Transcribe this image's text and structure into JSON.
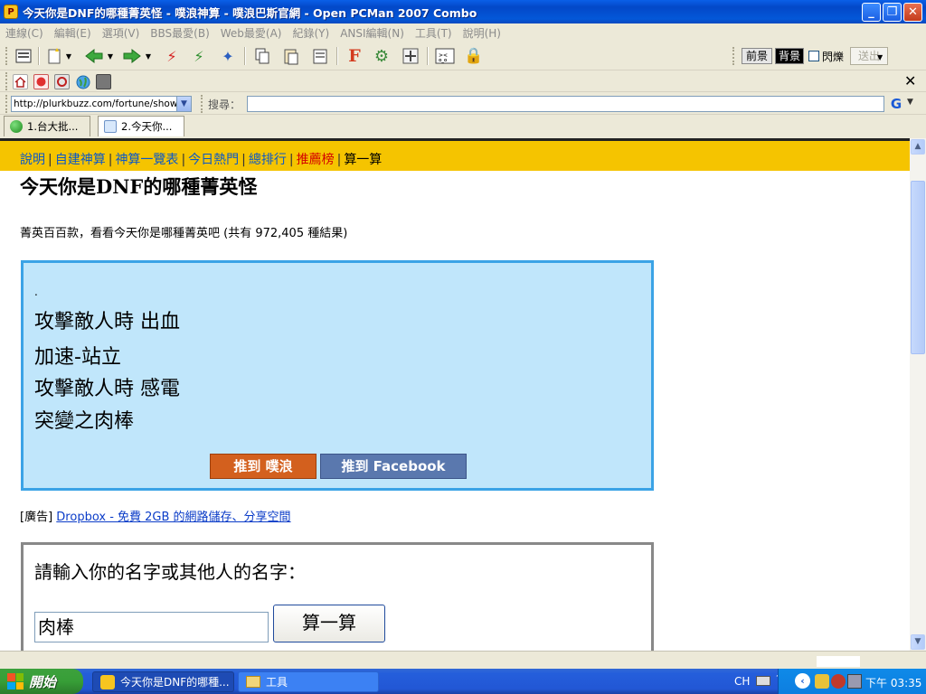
{
  "window": {
    "title": "今天你是DNF的哪種菁英怪 - 噗浪神算 - 噗浪巴斯官網 - Open PCMan 2007 Combo",
    "minimize": "_",
    "restore": "❐",
    "close": "✕"
  },
  "menu": [
    "連線(C)",
    "編輯(E)",
    "選項(V)",
    "BBS最愛(B)",
    "Web最愛(A)",
    "紀錄(Y)",
    "ANSI編輯(N)",
    "工具(T)",
    "說明(H)"
  ],
  "toolbar": {
    "fg_label": "前景",
    "bg_label": "背景",
    "blink_label": "閃爍",
    "send_label": "送出"
  },
  "address": {
    "url": "http://plurkbuzz.com/fortune/show/Dg",
    "search_label": "搜尋：",
    "search_value": ""
  },
  "tabs": [
    {
      "label": "1.台大批..."
    },
    {
      "label": "2.今天你..."
    }
  ],
  "page": {
    "nav": [
      {
        "label": "說明"
      },
      {
        "label": "自建神算"
      },
      {
        "label": "神算一覽表"
      },
      {
        "label": "今日熱門"
      },
      {
        "label": "總排行"
      },
      {
        "label": "推薦榜"
      },
      {
        "label": "算一算"
      }
    ],
    "nav_sep": "|",
    "title": "今天你是DNF的哪種菁英怪",
    "subtitle": "菁英百百款，看看今天你是哪種菁英吧 (共有 972,405 種結果)",
    "result_dot": ".",
    "result_lines": [
      "攻擊敵人時 出血",
      "加速-站立",
      "攻擊敵人時 感電",
      "突變之肉棒"
    ],
    "share_plurk": "推到 噗浪",
    "share_facebook": "推到 Facebook",
    "ad_prefix": "[廣告]",
    "ad_link": "Dropbox - 免費 2GB 的網路儲存、分享空間",
    "form_label": "請輸入你的名字或其他人的名字：",
    "name_value": "肉棒",
    "calc_button": "算一算"
  },
  "taskbar": {
    "start": "開始",
    "tasks": [
      {
        "label": "今天你是DNF的哪種..."
      },
      {
        "label": "工具"
      }
    ],
    "ime": "CH",
    "clock": "下午 03:35"
  }
}
